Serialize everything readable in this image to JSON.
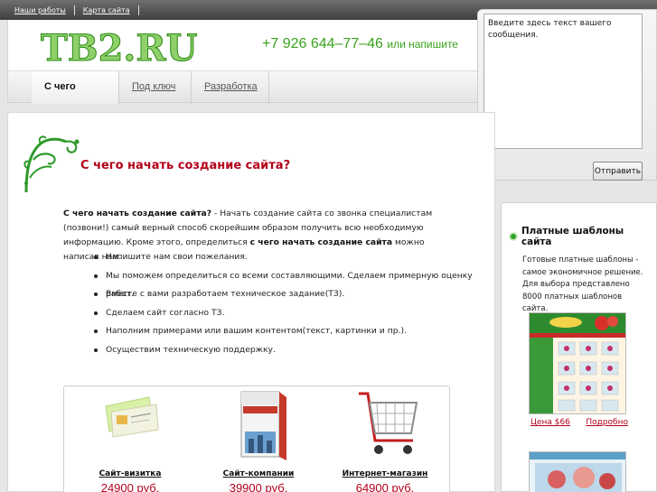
{
  "top_links": [
    "Наши работы",
    "Карта сайта"
  ],
  "logo": "TB2.RU",
  "phone": "+7 926 644–77–46",
  "phone_suffix": "или напишите",
  "nav": [
    "С чего начать",
    "Под ключ",
    "Разработка"
  ],
  "message": {
    "textarea_text": "Введите здесь текст вашего сообщения.",
    "send_label": "Отправить"
  },
  "main": {
    "heading": "С чего начать создание сайта?",
    "intro_bold1": "С чего начать создание сайта?",
    "intro_text1": " - Начать создание сайта со звонка специалистам (позвони!) самый верный способ скорейшим образом получить всю необходимую информацию. Кроме этого, определиться ",
    "intro_bold2": "с чего начать создание сайта",
    "intro_text2": " можно написав нам.",
    "list": [
      "Напишите нам свои пожелания.",
      "Мы поможем определиться со всеми составляющими. Сделаем примерную оценку работ.",
      "Вместе с вами разработаем техническое задание(ТЗ).",
      "Сделаем сайт согласно ТЗ.",
      "Наполним примерами или вашим контентом(текст, картинки и пр.).",
      "Осуществим техническую поддержку."
    ],
    "products": [
      {
        "name": "Сайт-визитка",
        "price": "24900 руб."
      },
      {
        "name": "Сайт-компании",
        "price": "39900 руб."
      },
      {
        "name": "Интернет-магазин",
        "price": "64900 руб."
      }
    ]
  },
  "sidebar": {
    "title": "Платные шаблоны сайта",
    "description": "Готовые платные шаблоны - самое экономичное решение. Для выбора представлено 8000 платных шаблонов сайта.",
    "template_price": "Цена $66",
    "template_link": "Подробно"
  },
  "colors": {
    "accent_red": "#b3001b",
    "green": "#39a11c"
  }
}
